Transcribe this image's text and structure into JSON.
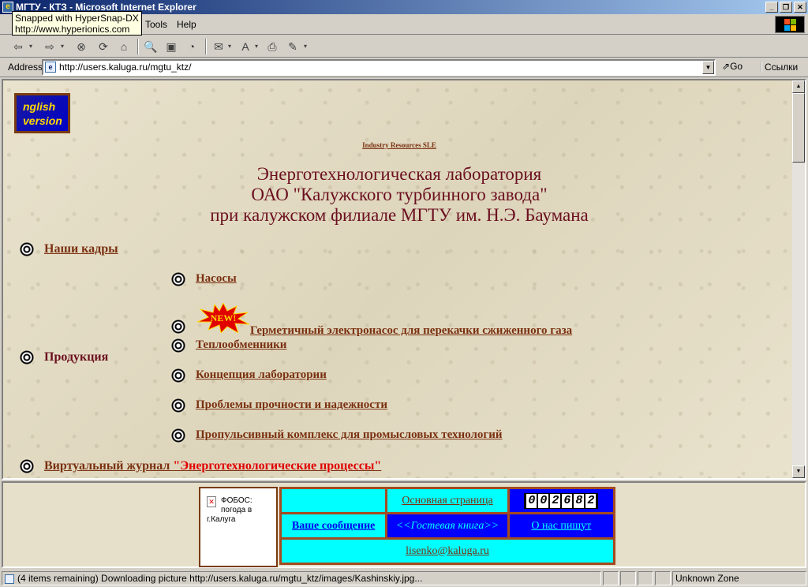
{
  "window": {
    "title": "МГТУ - КТЗ - Microsoft Internet Explorer"
  },
  "tooltip": {
    "line1": "Snapped with HyperSnap-DX",
    "line2": "http://www.hyperionics.com"
  },
  "menu": {
    "tools": "Tools",
    "help": "Help"
  },
  "address": {
    "label": "Address",
    "url": "http://users.kaluga.ru/mgtu_ktz/",
    "go": "Go",
    "links": "Ссылки"
  },
  "page": {
    "english_logo": "nglish\nversion",
    "industry_link": "Industry Resources SLE",
    "title_line1": "Энерготехнологическая лаборатория",
    "title_line2": "ОАО \"Калужского турбинного завода\"",
    "title_line3": "при калужском филиале МГТУ им. Н.Э. Баумана",
    "nav": {
      "staff": "Наши кадры",
      "products": "Продукция",
      "pumps": "Насосы",
      "new_badge": "NEW!",
      "sealed_pump": "Герметичный электронасос для перекачки сжиженного газа ",
      "heat_exchangers": "Теплообменники",
      "concept": "Концепция лаборатории",
      "strength": "Проблемы прочности и надежности",
      "propulsion": "Пропульсивный комплекс для промысловых технологий",
      "journal_prefix": "Виртуальный журнал ",
      "journal_title": "\"Энерготехнологические процессы\""
    }
  },
  "footer": {
    "weather": "ФОБОС: погода в г.Калуга",
    "main_page": "Основная страница",
    "counter": [
      "0",
      "0",
      "2",
      "6",
      "8",
      "2"
    ],
    "your_message": "Ваше сообщение ",
    "guestbook": "<<Гостевая книга>>",
    "about_us": "О нас пишут",
    "email": "lisenko@kaluga.ru"
  },
  "status": {
    "text": "(4 items remaining) Downloading picture http://users.kaluga.ru/mgtu_ktz/images/Kashinskiy.jpg...",
    "zone": "Unknown Zone"
  },
  "colors": {
    "title": "#6b0f1f",
    "link": "#7a3010",
    "cyan": "#00ffff",
    "blue": "#0000ff"
  }
}
